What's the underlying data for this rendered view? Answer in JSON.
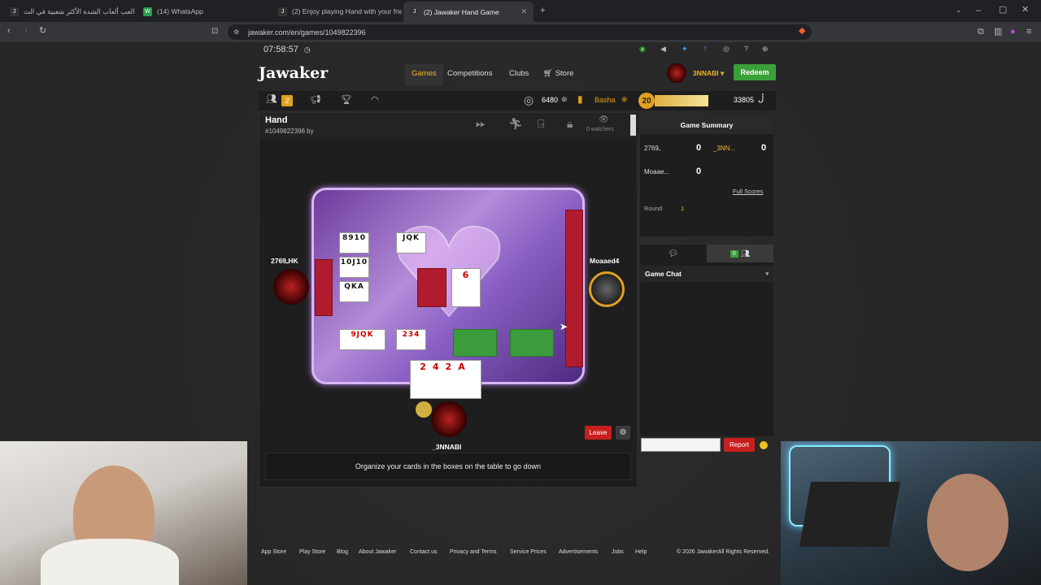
{
  "browser": {
    "tabs": [
      {
        "label": "العب ألعاب الشدة الأكثر شعبية في الث",
        "icon": "J"
      },
      {
        "label": "(14) WhatsApp",
        "icon": "W"
      },
      {
        "label": "(2) Enjoy playing Hand with your frie",
        "icon": "J"
      },
      {
        "label": "(2) Jawaker Hand Game",
        "icon": "J"
      }
    ],
    "url": "jawaker.com/en/games/1049822396"
  },
  "clock": "07:58:57",
  "nav": {
    "logo": "Jawaker",
    "games": "Games",
    "competitions": "Competitions",
    "clubs": "Clubs",
    "store": "Store",
    "username": "3NNABI",
    "redeem": "Redeem"
  },
  "subbar": {
    "badge": "2",
    "coins": "6480",
    "tier": "Basha",
    "level": "20",
    "points": "33805"
  },
  "game": {
    "title": "Hand",
    "id": "#1049822396 by",
    "watchers": "0 watchers",
    "instruction": "Organize your cards in the boxes on the table to go down"
  },
  "players": {
    "left": "2769ـHK",
    "right": "Moaaed4",
    "bottom": "_3NNABI"
  },
  "cards": {
    "g1": "8910",
    "g2": "JQK",
    "g3": "10J10",
    "g4": "QKA",
    "g5": "6",
    "g6": "9JQK",
    "g7": "234",
    "hand": "242A"
  },
  "summary": {
    "title": "Game Summary",
    "rows": [
      {
        "name": "2769ـ",
        "score": "0",
        "name2": "_3NN...",
        "score2": "0"
      },
      {
        "name": "Moaae...",
        "score": "0"
      }
    ],
    "full_scores": "Full Scores",
    "round_label": "Round",
    "round_value": "1"
  },
  "chat": {
    "online": "0",
    "title": "Game Chat",
    "report": "Report"
  },
  "buttons": {
    "leave": "Leave"
  },
  "footer": [
    "App Store",
    "Play Store",
    "Blog",
    "About Jawaker",
    "Contact us",
    "Privacy and Terms",
    "Service Prices",
    "Advertisements",
    "Jobs",
    "Help"
  ],
  "copyright": "© 2026 JawakerAll Rights Reserved."
}
